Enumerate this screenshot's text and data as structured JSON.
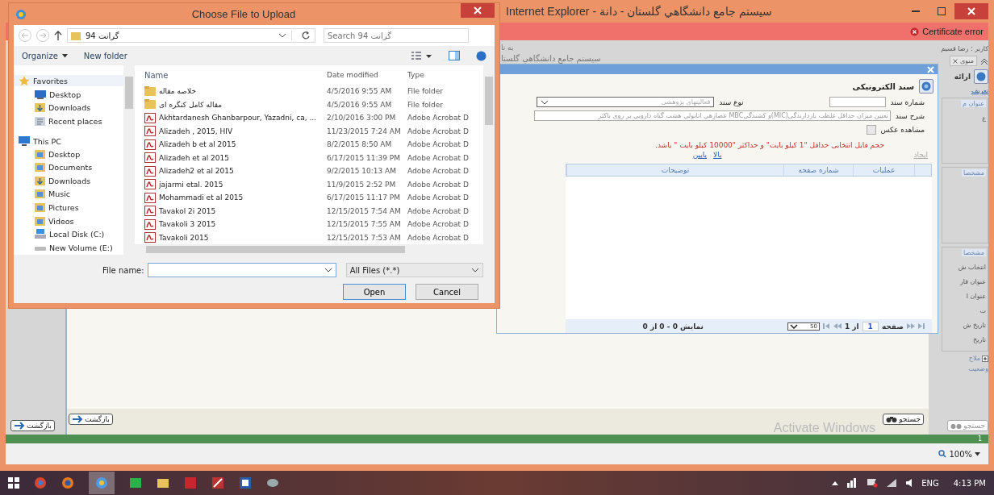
{
  "browser": {
    "title": "Internet Explorer - سیستم جامع دانشگاهي گلستان - دانة",
    "certificate_error": "Certificate error",
    "page_header": {
      "line_1": "به نا",
      "line_2": "سیستم جامع دانشگاهي گلستا"
    },
    "sidebar": {
      "user": "کاربر : رضا قسیم",
      "menu_tab": "منوی",
      "section_title": "ارائه",
      "link": "تعریف",
      "groups": [
        {
          "title": "عنوان م",
          "items": [
            "ع"
          ]
        },
        {
          "title": "مشخصا"
        },
        {
          "title": "مشخصا",
          "items": [
            "انتخاب ش",
            "عنوان فار",
            "عنوان ا",
            "ت",
            "تاریخ ش",
            "تاریخ"
          ]
        }
      ],
      "expander": "ملاح",
      "status": "وضعیت",
      "search_button": "جستجو"
    },
    "back_button_outer": "بازگشت",
    "back_button_inner": "بازگشت",
    "search_button": "جستجو",
    "status_number": "1",
    "activation": "Activate Windows",
    "zoom": "100%"
  },
  "upload_dialog": {
    "title": "Choose File to Upload",
    "path": "گرانت 94",
    "search_placeholder": "Search گرانت 94",
    "toolbar": {
      "organize": "Organize",
      "new_folder": "New folder"
    },
    "nav": [
      {
        "label": "Favorites",
        "kind": "star",
        "children": [
          {
            "label": "Desktop",
            "kind": "desktop"
          },
          {
            "label": "Downloads",
            "kind": "download"
          },
          {
            "label": "Recent places",
            "kind": "recent"
          }
        ]
      },
      {
        "label": "This PC",
        "kind": "pc",
        "children": [
          {
            "label": "Desktop",
            "kind": "folder"
          },
          {
            "label": "Documents",
            "kind": "folder"
          },
          {
            "label": "Downloads",
            "kind": "download"
          },
          {
            "label": "Music",
            "kind": "folder"
          },
          {
            "label": "Pictures",
            "kind": "folder"
          },
          {
            "label": "Videos",
            "kind": "folder"
          },
          {
            "label": "Local Disk (C:)",
            "kind": "disk"
          },
          {
            "label": "New Volume (E:)",
            "kind": "drive"
          }
        ]
      }
    ],
    "columns": {
      "name": "Name",
      "date": "Date modified",
      "type": "Type"
    },
    "files": [
      {
        "name": "خلاصه مقاله",
        "date": "4/5/2016 9:55 AM",
        "type": "File folder",
        "kind": "folder"
      },
      {
        "name": "مقاله کامل کنگره ای",
        "date": "4/5/2016 9:55 AM",
        "type": "File folder",
        "kind": "folder"
      },
      {
        "name": "Akhtardanesh Ghanbarpour, Yazadni, ca, ...",
        "date": "2/10/2016 3:00 PM",
        "type": "Adobe Acrobat D",
        "kind": "pdf"
      },
      {
        "name": "Alizadeh , 2015, HIV",
        "date": "11/23/2015 7:24 AM",
        "type": "Adobe Acrobat D",
        "kind": "pdf"
      },
      {
        "name": "Alizadeh b et al 2015",
        "date": "8/2/2015 8:50 AM",
        "type": "Adobe Acrobat D",
        "kind": "pdf"
      },
      {
        "name": "Alizadeh et al 2015",
        "date": "6/17/2015 11:39 PM",
        "type": "Adobe Acrobat D",
        "kind": "pdf"
      },
      {
        "name": "Alizadeh2 et al 2015",
        "date": "9/2/2015 10:13 AM",
        "type": "Adobe Acrobat D",
        "kind": "pdf"
      },
      {
        "name": "jajarmi etal. 2015",
        "date": "11/9/2015 2:52 PM",
        "type": "Adobe Acrobat D",
        "kind": "pdf"
      },
      {
        "name": "Mohammadi et al 2015",
        "date": "6/17/2015 11:17 PM",
        "type": "Adobe Acrobat D",
        "kind": "pdf"
      },
      {
        "name": "Tavakol 2i 2015",
        "date": "12/15/2015 7:54 AM",
        "type": "Adobe Acrobat D",
        "kind": "pdf"
      },
      {
        "name": "Tavakoli 3 2015",
        "date": "12/15/2015 7:55 AM",
        "type": "Adobe Acrobat D",
        "kind": "pdf"
      },
      {
        "name": "Tavakoli 2015",
        "date": "12/15/2015 7:53 AM",
        "type": "Adobe Acrobat D",
        "kind": "pdf"
      }
    ],
    "file_name_label": "File name:",
    "filter": "All Files (*.*)",
    "open_button": "Open",
    "cancel_button": "Cancel"
  },
  "document_modal": {
    "heading": "سند الکترونیکی",
    "number_label": "شماره سند",
    "type_label": "نوع سند",
    "type_value": "فعالیتهای پژوهشی",
    "description_label": "شرح سند",
    "description_value": "تعیین میزان حداقل غلظت بازدارندگی(MIC)و کشندگیMBC عصارهي اتانولي هشت گیاه دارویي بر روی باکتر",
    "photo_label": "مشاهده عکس",
    "photo_checked": false,
    "warning": "حجم فایل انتخابی حداقل \"1 کیلو بایت\" و حداکثر \"10000 کیلو بایت \" باشد.",
    "links": [
      {
        "label": "ایجاد",
        "disabled": true
      },
      {
        "label": "بالا",
        "disabled": false
      },
      {
        "label": "پایین",
        "disabled": false
      }
    ],
    "columns": [
      "عملیات",
      "شماره صفحه",
      "توضیحات"
    ],
    "pager": {
      "page_label": "صفحه",
      "page": "1",
      "of": "از 1",
      "page_size": "50",
      "summary": "نمایش 0 - 0 از 0"
    }
  },
  "taskbar": {
    "language": "ENG",
    "time": "4:13 PM"
  }
}
